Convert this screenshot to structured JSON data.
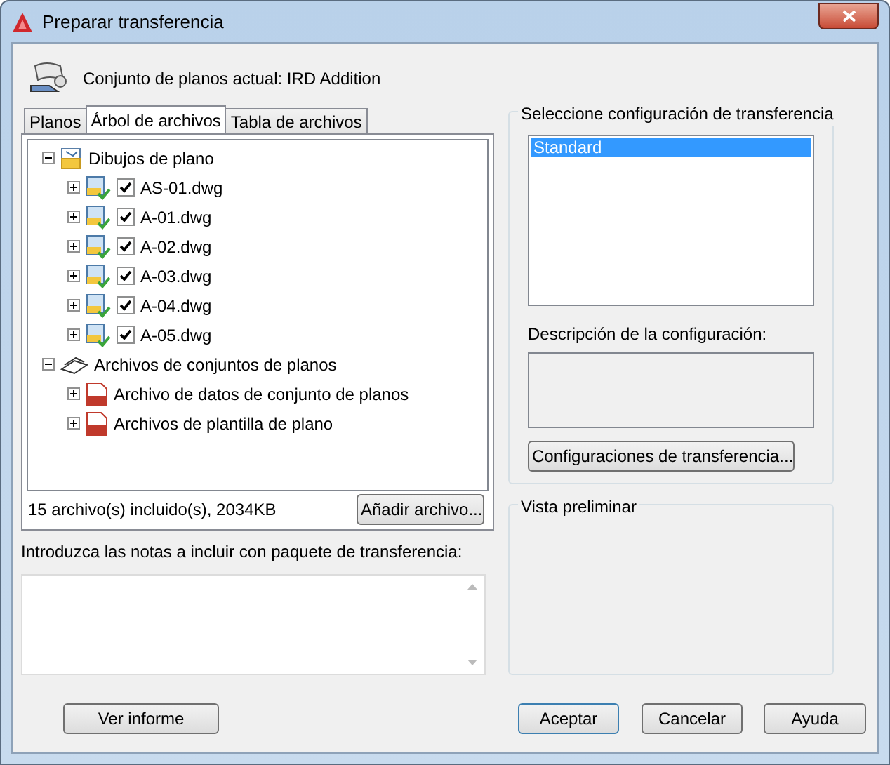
{
  "window": {
    "title": "Preparar transferencia"
  },
  "current_set": "Conjunto de planos actual: IRD Addition",
  "tabs": [
    {
      "label": "Planos",
      "selected": false
    },
    {
      "label": "Árbol de archivos",
      "selected": true
    },
    {
      "label": "Tabla de archivos",
      "selected": false
    }
  ],
  "tree": [
    {
      "label": "Dibujos de plano",
      "kind": "drawings",
      "expanded": true,
      "children": [
        {
          "label": "AS-01.dwg",
          "kind": "dwg",
          "checked": true,
          "expanded": false
        },
        {
          "label": "A-01.dwg",
          "kind": "dwg",
          "checked": true,
          "expanded": false
        },
        {
          "label": "A-02.dwg",
          "kind": "dwg",
          "checked": true,
          "expanded": false
        },
        {
          "label": "A-03.dwg",
          "kind": "dwg",
          "checked": true,
          "expanded": false
        },
        {
          "label": "A-04.dwg",
          "kind": "dwg",
          "checked": true,
          "expanded": false
        },
        {
          "label": "A-05.dwg",
          "kind": "dwg",
          "checked": true,
          "expanded": false
        }
      ]
    },
    {
      "label": "Archivos de conjuntos de planos",
      "kind": "sheetset",
      "expanded": true,
      "children": [
        {
          "label": "Archivo de datos de conjunto de planos",
          "kind": "dst",
          "expanded": false
        },
        {
          "label": "Archivos de plantilla de plano",
          "kind": "dwt",
          "expanded": false
        }
      ]
    }
  ],
  "file_summary": "15 archivo(s) incluido(s), 2034KB",
  "add_file_button": "Añadir archivo...",
  "notes": {
    "label": "Introduzca las notas a incluir con paquete de transferencia:"
  },
  "setup": {
    "legend": "Seleccione configuración de transferencia",
    "items": [
      {
        "label": "Standard",
        "selected": true
      }
    ],
    "description_label": "Descripción de la configuración:",
    "button": "Configuraciones de transferencia..."
  },
  "preview": {
    "legend": "Vista preliminar"
  },
  "buttons": {
    "report": "Ver informe",
    "ok": "Aceptar",
    "cancel": "Cancelar",
    "help": "Ayuda"
  }
}
